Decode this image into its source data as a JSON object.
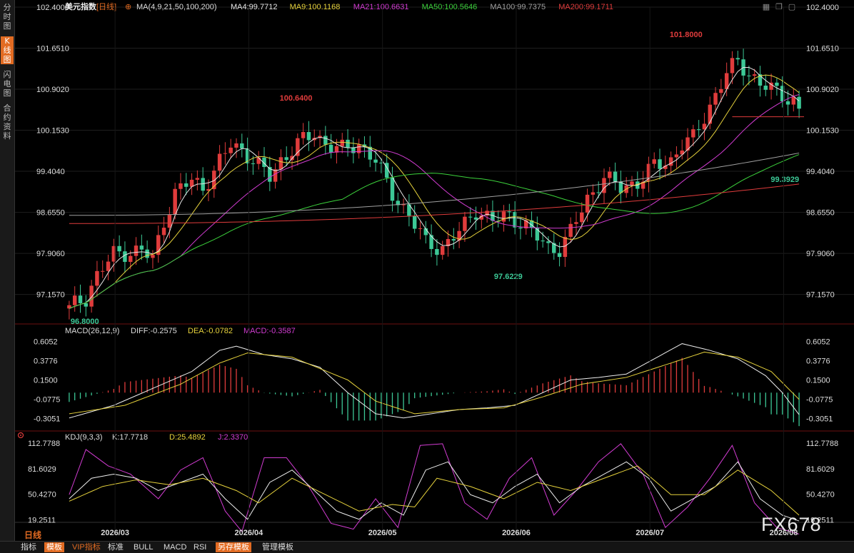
{
  "sidebar": {
    "tabs": [
      {
        "label": "分时图",
        "active": false
      },
      {
        "label": "K线图",
        "active": true
      },
      {
        "label": "闪电图",
        "active": false
      },
      {
        "label": "合约资料",
        "active": false
      }
    ]
  },
  "header": {
    "title": "美元指数",
    "period": "[日线]",
    "ma_label": "MA(4,9,21,50,100,200)",
    "ma_values": [
      {
        "label": "MA4:99.7712",
        "color": "#e6e6e6"
      },
      {
        "label": "MA9:100.1168",
        "color": "#e6d23c"
      },
      {
        "label": "MA21:100.6631",
        "color": "#d23cd2"
      },
      {
        "label": "MA50:100.5646",
        "color": "#3cd23c"
      },
      {
        "label": "MA100:99.7375",
        "color": "#a0a0a0"
      },
      {
        "label": "MA200:99.1711",
        "color": "#e03c3c"
      }
    ]
  },
  "macd_header": {
    "label": "MACD(26,12,9)",
    "diff": "DIFF:-0.2575",
    "dea": "DEA:-0.0782",
    "macd": "MACD:-0.3587"
  },
  "kdj_header": {
    "label": "KDJ(9,3,3)",
    "k": "K:17.7718",
    "d": "D:25.4892",
    "j": "J:2.3370"
  },
  "price_axis": [
    "102.4000",
    "101.6510",
    "100.9020",
    "100.1530",
    "99.4040",
    "98.6550",
    "97.9060",
    "97.1570"
  ],
  "macd_axis": [
    "0.6052",
    "0.3776",
    "0.1500",
    "-0.0775",
    "-0.3051"
  ],
  "kdj_axis": [
    "112.7788",
    "81.6029",
    "50.4270",
    "19.2511"
  ],
  "x_axis": [
    "2026/03",
    "2026/04",
    "2026/05",
    "2026/06",
    "2026/07",
    "2026/08"
  ],
  "annotations": {
    "high1": "100.6400",
    "high2": "101.8000",
    "low1": "96.8000",
    "low2": "97.6229",
    "last_low": "99.3929"
  },
  "colors": {
    "up": "#e03c3c",
    "down": "#3cc896",
    "accent": "#e26b22"
  },
  "bottom_bar": {
    "period_label": "日线",
    "tabs": [
      {
        "label": "指标",
        "style": "normal"
      },
      {
        "label": "模板",
        "style": "hl"
      },
      {
        "label": "VIP指标",
        "style": "vip"
      },
      {
        "label": "标准",
        "style": "normal"
      },
      {
        "label": "BULL",
        "style": "normal"
      },
      {
        "label": "MACD",
        "style": "normal"
      },
      {
        "label": "RSI",
        "style": "normal"
      },
      {
        "label": "另存模板",
        "style": "hl"
      },
      {
        "label": "管理模板",
        "style": "normal"
      }
    ]
  },
  "watermark": "FX678",
  "chart_data": [
    {
      "type": "candlestick",
      "title": "美元指数",
      "ylim": [
        96.8,
        102.4
      ],
      "candle_count": 132,
      "x_labels": [
        "2026/03",
        "2026/04",
        "2026/05",
        "2026/06",
        "2026/07",
        "2026/08"
      ],
      "anchors": [
        [
          0,
          96.9
        ],
        [
          3,
          97.1
        ],
        [
          5,
          97.5
        ],
        [
          8,
          97.9
        ],
        [
          13,
          97.95
        ],
        [
          15,
          97.8
        ],
        [
          17,
          98.5
        ],
        [
          19,
          99.0
        ],
        [
          22,
          99.25
        ],
        [
          24,
          99.1
        ],
        [
          26,
          99.4
        ],
        [
          29,
          99.9
        ],
        [
          31,
          99.8
        ],
        [
          34,
          99.5
        ],
        [
          36,
          99.3
        ],
        [
          38,
          99.6
        ],
        [
          41,
          99.9
        ],
        [
          44,
          100.1
        ],
        [
          46,
          99.9
        ],
        [
          49,
          99.8
        ],
        [
          52,
          99.9
        ],
        [
          55,
          99.6
        ],
        [
          58,
          99.0
        ],
        [
          61,
          98.6
        ],
        [
          64,
          98.1
        ],
        [
          67,
          98.0
        ],
        [
          70,
          98.3
        ],
        [
          73,
          98.7
        ],
        [
          76,
          98.5
        ],
        [
          79,
          98.6
        ],
        [
          82,
          98.4
        ],
        [
          84,
          98.2
        ],
        [
          86,
          98.0
        ],
        [
          88,
          98.0
        ],
        [
          90,
          98.3
        ],
        [
          93,
          98.9
        ],
        [
          96,
          99.3
        ],
        [
          99,
          99.1
        ],
        [
          102,
          99.2
        ],
        [
          105,
          99.5
        ],
        [
          108,
          99.6
        ],
        [
          110,
          99.9
        ],
        [
          112,
          100.0
        ],
        [
          115,
          100.6
        ],
        [
          118,
          101.2
        ],
        [
          120,
          101.4
        ],
        [
          122,
          101.2
        ],
        [
          124,
          101.0
        ],
        [
          126,
          100.9
        ],
        [
          128,
          100.8
        ],
        [
          130,
          100.7
        ],
        [
          131,
          100.5
        ]
      ],
      "close_series": [
        96.9,
        96.98,
        97.04,
        97.1,
        97.31,
        97.5,
        97.63,
        97.77,
        97.9,
        97.91,
        97.92,
        97.93,
        97.94,
        97.95,
        97.88,
        97.8,
        98.15,
        98.5,
        98.75,
        99.0,
        99.08,
        99.17,
        99.25,
        99.18,
        99.1,
        99.25,
        99.4,
        99.57,
        99.73,
        99.9,
        99.85,
        99.8,
        99.7,
        99.6,
        99.5,
        99.4,
        99.3,
        99.45,
        99.6,
        99.7,
        99.8,
        99.9,
        99.97,
        100.03,
        100.1,
        100.0,
        99.9,
        99.87,
        99.83,
        99.8,
        99.83,
        99.87,
        99.9,
        99.8,
        99.7,
        99.6,
        99.4,
        99.2,
        99.0,
        98.87,
        98.73,
        98.6,
        98.43,
        98.27,
        98.1,
        98.07,
        98.03,
        98.0,
        98.1,
        98.2,
        98.3,
        98.43,
        98.57,
        98.7,
        98.63,
        98.57,
        98.5,
        98.53,
        98.57,
        98.6,
        98.53,
        98.47,
        98.4,
        98.3,
        98.2,
        98.1,
        98.0,
        98.0,
        98.0,
        98.15,
        98.3,
        98.5,
        98.7,
        98.9,
        99.03,
        99.17,
        99.3,
        99.23,
        99.17,
        99.1,
        99.13,
        99.17,
        99.2,
        99.3,
        99.4,
        99.5,
        99.53,
        99.57,
        99.6,
        99.75,
        99.9,
        99.95,
        100.0,
        100.2,
        100.4,
        100.6,
        100.8,
        101.0,
        101.2,
        101.3,
        101.4,
        101.3,
        101.2,
        101.1,
        101.0,
        100.95,
        100.9,
        100.85,
        100.8,
        100.75,
        100.7,
        100.5
      ],
      "peaks": [
        {
          "x": 37,
          "y": 100.64,
          "label": "100.6400"
        },
        {
          "x": 107,
          "y": 101.8,
          "label": "101.8000"
        }
      ],
      "troughs": [
        {
          "x": 0,
          "y": 96.8,
          "label": "96.8000"
        },
        {
          "x": 76,
          "y": 97.6229,
          "label": "97.6229"
        },
        {
          "x": 131,
          "y": 99.3929,
          "label": "99.3929"
        }
      ],
      "ma_series": [
        {
          "name": "MA4",
          "value": 99.7712,
          "color": "#e6e6e6"
        },
        {
          "name": "MA9",
          "value": 100.1168,
          "color": "#e6d23c"
        },
        {
          "name": "MA21",
          "value": 100.6631,
          "color": "#d23cd2"
        },
        {
          "name": "MA50",
          "value": 100.5646,
          "color": "#3cd23c"
        },
        {
          "name": "MA100",
          "value": 99.7375,
          "color": "#a0a0a0"
        },
        {
          "name": "MA200",
          "value": 99.1711,
          "color": "#e03c3c"
        }
      ]
    },
    {
      "type": "bar",
      "title": "MACD(26,12,9)",
      "ylim": [
        -0.42,
        0.72
      ],
      "diff": -0.2575,
      "dea": -0.0782,
      "macd": -0.3587,
      "diff_anchors": [
        [
          0,
          -0.3
        ],
        [
          8,
          -0.15
        ],
        [
          15,
          0.05
        ],
        [
          22,
          0.25
        ],
        [
          27,
          0.5
        ],
        [
          30,
          0.55
        ],
        [
          35,
          0.45
        ],
        [
          40,
          0.4
        ],
        [
          45,
          0.3
        ],
        [
          50,
          0.0
        ],
        [
          55,
          -0.25
        ],
        [
          60,
          -0.3
        ],
        [
          65,
          -0.25
        ],
        [
          70,
          -0.2
        ],
        [
          75,
          -0.18
        ],
        [
          80,
          -0.15
        ],
        [
          85,
          0.0
        ],
        [
          90,
          0.15
        ],
        [
          95,
          0.18
        ],
        [
          100,
          0.22
        ],
        [
          105,
          0.4
        ],
        [
          110,
          0.58
        ],
        [
          115,
          0.5
        ],
        [
          120,
          0.4
        ],
        [
          125,
          0.2
        ],
        [
          128,
          0.0
        ],
        [
          131,
          -0.26
        ]
      ],
      "dea_anchors": [
        [
          0,
          -0.25
        ],
        [
          10,
          -0.15
        ],
        [
          20,
          0.1
        ],
        [
          27,
          0.35
        ],
        [
          32,
          0.47
        ],
        [
          40,
          0.42
        ],
        [
          50,
          0.15
        ],
        [
          55,
          -0.1
        ],
        [
          62,
          -0.25
        ],
        [
          70,
          -0.2
        ],
        [
          78,
          -0.18
        ],
        [
          85,
          -0.05
        ],
        [
          92,
          0.1
        ],
        [
          100,
          0.18
        ],
        [
          108,
          0.35
        ],
        [
          114,
          0.48
        ],
        [
          120,
          0.42
        ],
        [
          126,
          0.25
        ],
        [
          131,
          -0.08
        ]
      ]
    },
    {
      "type": "line",
      "title": "KDJ(9,3,3)",
      "ylim": [
        5,
        118
      ],
      "k": 17.7718,
      "d": 25.4892,
      "j": 2.337,
      "k_anchors": [
        [
          0,
          45
        ],
        [
          4,
          70
        ],
        [
          8,
          75
        ],
        [
          12,
          70
        ],
        [
          16,
          55
        ],
        [
          20,
          65
        ],
        [
          24,
          75
        ],
        [
          28,
          45
        ],
        [
          32,
          20
        ],
        [
          36,
          65
        ],
        [
          40,
          80
        ],
        [
          44,
          55
        ],
        [
          48,
          30
        ],
        [
          52,
          20
        ],
        [
          56,
          40
        ],
        [
          60,
          25
        ],
        [
          64,
          80
        ],
        [
          68,
          90
        ],
        [
          72,
          50
        ],
        [
          76,
          40
        ],
        [
          80,
          60
        ],
        [
          84,
          75
        ],
        [
          88,
          40
        ],
        [
          92,
          60
        ],
        [
          96,
          75
        ],
        [
          100,
          90
        ],
        [
          104,
          70
        ],
        [
          108,
          30
        ],
        [
          112,
          45
        ],
        [
          116,
          60
        ],
        [
          120,
          90
        ],
        [
          124,
          45
        ],
        [
          128,
          25
        ],
        [
          131,
          18
        ]
      ],
      "d_anchors": [
        [
          0,
          42
        ],
        [
          6,
          60
        ],
        [
          12,
          68
        ],
        [
          18,
          62
        ],
        [
          24,
          70
        ],
        [
          30,
          55
        ],
        [
          34,
          40
        ],
        [
          40,
          70
        ],
        [
          46,
          50
        ],
        [
          52,
          30
        ],
        [
          58,
          38
        ],
        [
          62,
          35
        ],
        [
          66,
          70
        ],
        [
          72,
          60
        ],
        [
          78,
          45
        ],
        [
          84,
          65
        ],
        [
          90,
          55
        ],
        [
          96,
          70
        ],
        [
          102,
          85
        ],
        [
          108,
          50
        ],
        [
          114,
          50
        ],
        [
          120,
          80
        ],
        [
          126,
          55
        ],
        [
          131,
          25
        ]
      ],
      "j_anchors": [
        [
          0,
          50
        ],
        [
          3,
          105
        ],
        [
          7,
          85
        ],
        [
          11,
          75
        ],
        [
          16,
          45
        ],
        [
          20,
          80
        ],
        [
          24,
          95
        ],
        [
          28,
          30
        ],
        [
          31,
          5
        ],
        [
          35,
          95
        ],
        [
          39,
          95
        ],
        [
          43,
          60
        ],
        [
          47,
          15
        ],
        [
          51,
          8
        ],
        [
          55,
          45
        ],
        [
          59,
          10
        ],
        [
          63,
          110
        ],
        [
          67,
          112
        ],
        [
          71,
          40
        ],
        [
          75,
          20
        ],
        [
          79,
          70
        ],
        [
          83,
          95
        ],
        [
          87,
          25
        ],
        [
          91,
          55
        ],
        [
          95,
          90
        ],
        [
          99,
          112
        ],
        [
          103,
          75
        ],
        [
          107,
          10
        ],
        [
          111,
          35
        ],
        [
          115,
          70
        ],
        [
          119,
          110
        ],
        [
          123,
          40
        ],
        [
          127,
          10
        ],
        [
          131,
          2
        ]
      ]
    }
  ]
}
